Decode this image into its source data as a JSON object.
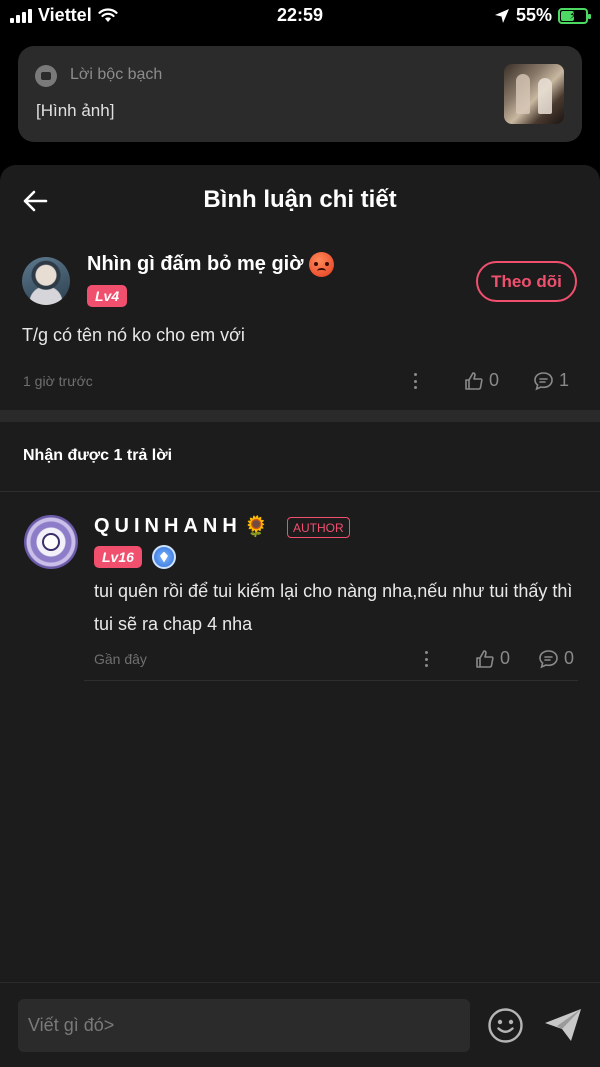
{
  "status_bar": {
    "carrier": "Viettel",
    "time": "22:59",
    "battery": "55%",
    "battery_level": 0.55
  },
  "confession": {
    "label": "Lời bộc bạch",
    "text": "[Hình ảnh]"
  },
  "panel": {
    "title": "Bình luận chi tiết"
  },
  "comment": {
    "author": "Nhìn gì đấm bỏ mẹ giờ",
    "level": "Lv4",
    "follow_label": "Theo dõi",
    "text": "T/g có tên nó ko cho em với",
    "time": "1 giờ trước",
    "likes": "0",
    "replies": "1"
  },
  "replies_header": "Nhận được 1 trả lời",
  "reply": {
    "author": "QUINHANH",
    "emoji": "🌻",
    "badge": "AUTHOR",
    "level": "Lv16",
    "text": "tui quên rồi để tui kiếm lại cho nàng nha,nếu như tui thấy thì tui sẽ ra chap 4 nha",
    "time": "Gần đây",
    "likes": "0",
    "replies": "0"
  },
  "input": {
    "placeholder": "Viết gì đó>"
  },
  "colors": {
    "accent": "#f0506e",
    "panel_bg": "#1c1c1d",
    "card_bg": "#2b2b2b",
    "battery": "#4cd964"
  }
}
